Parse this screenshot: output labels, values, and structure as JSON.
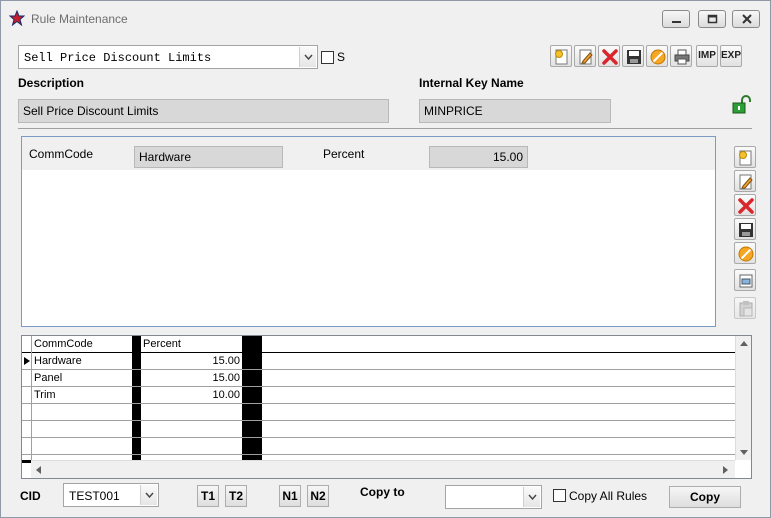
{
  "window": {
    "title": "Rule Maintenance",
    "app_icon": "star-icon",
    "controls": [
      "minimize-icon",
      "maximize-icon",
      "close-icon"
    ]
  },
  "rule_select": {
    "value": "Sell Price Discount Limits"
  },
  "s_checkbox": {
    "label": "S",
    "checked": false
  },
  "top_toolbar": {
    "buttons": [
      {
        "name": "new-icon"
      },
      {
        "name": "edit-icon"
      },
      {
        "name": "delete-icon"
      },
      {
        "name": "save-icon"
      },
      {
        "name": "cancel-icon"
      },
      {
        "name": "print-icon"
      },
      {
        "name": "import",
        "label": "IMP"
      },
      {
        "name": "export",
        "label": "EXP"
      }
    ]
  },
  "description": {
    "label": "Description",
    "value": "Sell Price Discount Limits"
  },
  "internal_key": {
    "label": "Internal Key Name",
    "value": "MINPRICE"
  },
  "lock_icon": "unlock-icon",
  "detail": {
    "commcode_label": "CommCode",
    "commcode_value": "Hardware",
    "percent_label": "Percent",
    "percent_value": "15.00"
  },
  "side_toolbar": [
    "new-icon",
    "edit-icon",
    "delete-icon",
    "save-icon",
    "cancel-icon",
    "copy-record-icon",
    "paste-icon"
  ],
  "grid": {
    "columns": [
      "CommCode",
      "Percent"
    ],
    "rows": [
      {
        "commcode": "Hardware",
        "percent": "15.00",
        "current": true
      },
      {
        "commcode": "Panel",
        "percent": "15.00"
      },
      {
        "commcode": "Trim",
        "percent": "10.00"
      }
    ]
  },
  "footer": {
    "cid_label": "CID",
    "cid_value": "TEST001",
    "t1": "T1",
    "t2": "T2",
    "n1": "N1",
    "n2": "N2",
    "copy_to_label": "Copy to",
    "copy_to_value": "",
    "copy_all_label": "Copy All Rules",
    "copy_all_checked": false,
    "copy_button": "Copy"
  },
  "colors": {
    "window_bg": "#f0f0f0",
    "field_bg": "#d8d8d8",
    "detail_border": "#7a9cc4",
    "grid_sep": "#000000"
  }
}
